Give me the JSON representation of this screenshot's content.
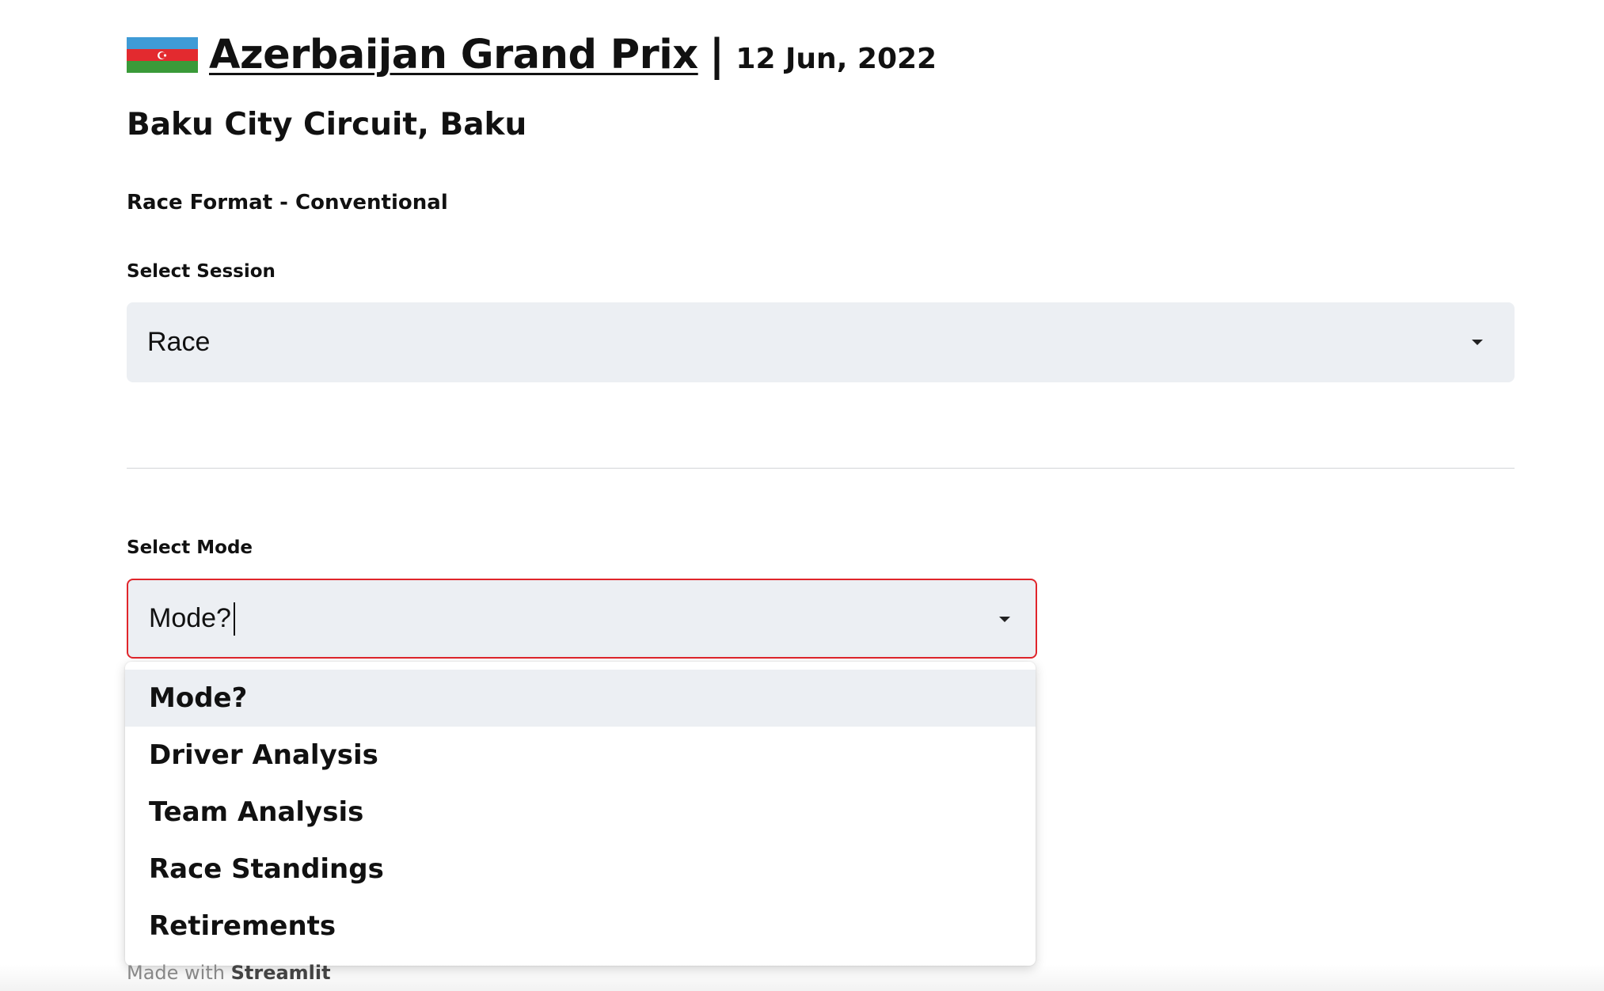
{
  "header": {
    "flag": "azerbaijan-flag",
    "race_name": "Azerbaijan Grand Prix",
    "separator": "|",
    "date": "12 Jun, 2022",
    "circuit": "Baku City Circuit, Baku",
    "race_format": "Race Format - Conventional"
  },
  "session_select": {
    "label": "Select Session",
    "value": "Race"
  },
  "mode_select": {
    "label": "Select Mode",
    "value": "Mode?",
    "options": [
      "Mode?",
      "Driver Analysis",
      "Team Analysis",
      "Race Standings",
      "Retirements"
    ],
    "highlighted": "Mode?"
  },
  "footer": {
    "prefix": "Made with",
    "brand": "Streamlit"
  },
  "colors": {
    "focus_border": "#e0252b",
    "select_bg": "#eceff3",
    "flag_blue": "#3f9bd6",
    "flag_red": "#e32a2f",
    "flag_green": "#3a9a39"
  }
}
